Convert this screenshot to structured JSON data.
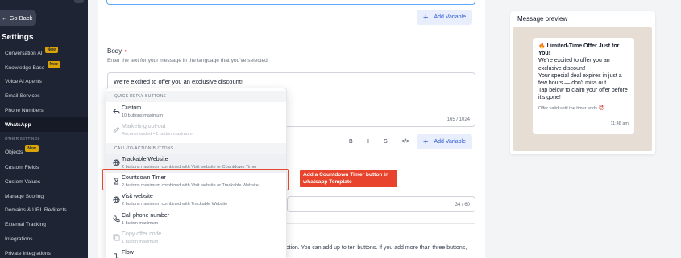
{
  "sidebar": {
    "go_back": "← Go Back",
    "title": "Settings",
    "section_other": "OTHER SETTINGS",
    "items": [
      {
        "label": "Conversation AI",
        "badge": "New"
      },
      {
        "label": "Knowledge Base",
        "badge": "New"
      },
      {
        "label": "Voice AI Agents",
        "badge": ""
      },
      {
        "label": "Email Services",
        "badge": ""
      },
      {
        "label": "Phone Numbers",
        "badge": ""
      },
      {
        "label": "WhatsApp",
        "badge": "",
        "active": true
      },
      {
        "label": "Objects",
        "badge": "New"
      },
      {
        "label": "Custom Fields",
        "badge": ""
      },
      {
        "label": "Custom Values",
        "badge": ""
      },
      {
        "label": "Manage Scoring",
        "badge": ""
      },
      {
        "label": "Domains & URL Redirects",
        "badge": ""
      },
      {
        "label": "External Tracking",
        "badge": ""
      },
      {
        "label": "Integrations",
        "badge": ""
      },
      {
        "label": "Private Integrations",
        "badge": ""
      }
    ]
  },
  "editor": {
    "add_variable": "Add Variable",
    "body_label": "Body",
    "required_mark": "•",
    "body_help": "Enter the text for your message in the language that you've selected.",
    "body_text": "We're excited to offer you an exclusive discount!",
    "body_counter": "165 / 1024",
    "format": {
      "bold": "B",
      "italic": "I",
      "strike": "S",
      "code": "</>"
    },
    "field2_counter": "34 / 60",
    "bottom_text": "ction. You can add up to ten buttons. If you add more than three buttons,"
  },
  "dropdown": {
    "quick_reply_header": "QUICK REPLY BUTTONS",
    "cta_header": "CALL-TO-ACTION BUTTONS",
    "items": [
      {
        "title": "Custom",
        "sub": "10 buttons maximum",
        "icon": "reply-icon"
      },
      {
        "title": "Marketing opt-out",
        "sub": "Recommended • 1 button maximum",
        "icon": "pencil-icon",
        "disabled": true
      },
      {
        "title": "Trackable Website",
        "sub": "2 buttons maximum combined with Visit website or Countdown Timer",
        "icon": "globe-icon"
      },
      {
        "title": "Countdown Timer",
        "sub": "2 buttons maximum combined with Visit website or Trackable Website",
        "icon": "hourglass-icon"
      },
      {
        "title": "Visit website",
        "sub": "2 buttons maximum combined with Trackable Website",
        "icon": "globe-icon"
      },
      {
        "title": "Call phone number",
        "sub": "1 button maximum",
        "icon": "phone-icon"
      },
      {
        "title": "Copy offer code",
        "sub": "1 button maximum",
        "icon": "copy-icon",
        "disabled": true
      },
      {
        "title": "Flow",
        "sub": "",
        "icon": "flow-icon"
      }
    ]
  },
  "callout": "Add a Countdown Timer button in whatsapp Template",
  "preview": {
    "title": "Message preview",
    "header": "🔥 Limited-Time Offer Just for You!",
    "lines": [
      "We're excited to offer you an exclusive discount!",
      "Your special deal expires in just a few hours — don't miss out.",
      "Tap below to claim your offer before it's gone!"
    ],
    "footer": "Offer valid until the timer ends ⏰",
    "time": "11:48 am"
  },
  "colors": {
    "sidebar": "#1e2433",
    "accent": "#2f5bd3",
    "callout": "#e8432c",
    "badge": "#d9a406"
  }
}
